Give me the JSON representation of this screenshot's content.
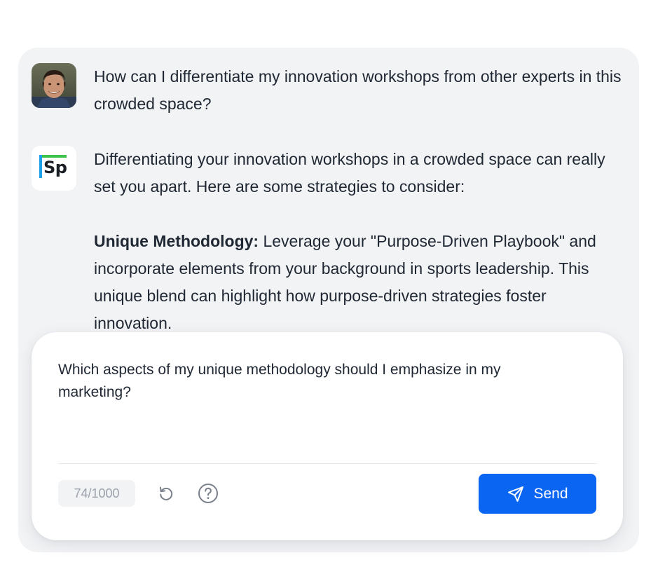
{
  "conversation": {
    "user_message": "How can I differentiate my innovation workshops from other experts in this crowded space?",
    "assistant_logo_text": "Sp",
    "assistant_intro": "Differentiating your innovation workshops in a crowded space can really set you apart. Here are some strategies to consider:",
    "assistant_point_title": "Unique Methodology:",
    "assistant_point_body": " Leverage your \"Purpose-Driven Playbook\" and incorporate elements from your background in sports leadership. This unique blend can highlight how purpose-driven strategies foster innovation."
  },
  "composer": {
    "input_value": "Which aspects of my unique methodology should I emphasize in my marketing?",
    "char_count": "74/1000",
    "send_label": "Send",
    "icons": [
      "reset-icon",
      "help-icon",
      "send-icon"
    ]
  },
  "colors": {
    "panel_background": "#f2f3f5",
    "send_button": "#0a66f2",
    "logo_green": "#3ec24a",
    "logo_blue": "#1ea0e8"
  }
}
